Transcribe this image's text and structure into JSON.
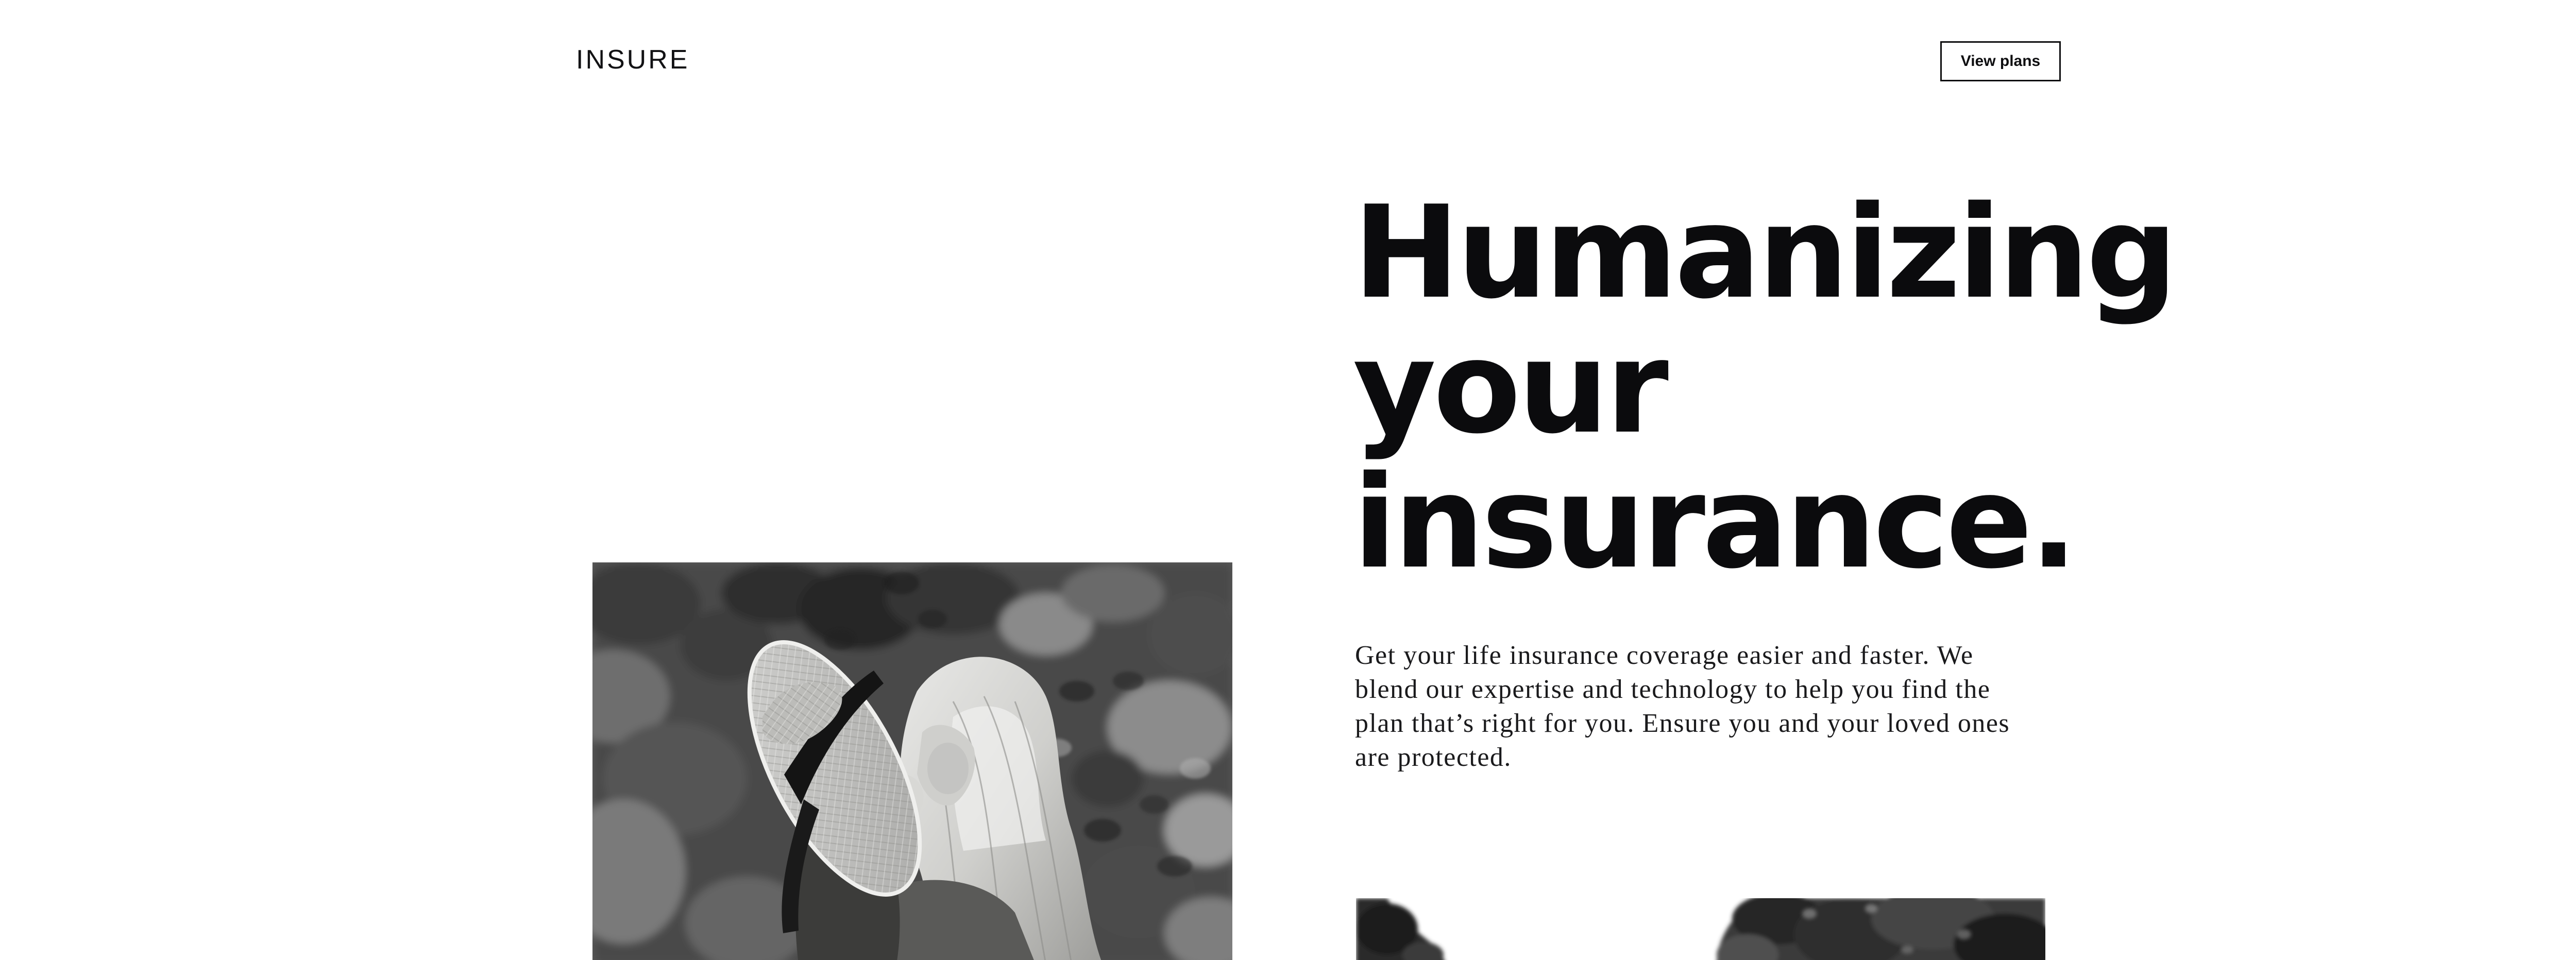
{
  "header": {
    "logo_text": "INSURE",
    "cta_label": "View plans"
  },
  "hero": {
    "title_lines": [
      "Humanizing",
      "your",
      "insurance."
    ],
    "description": "Get your life insurance coverage easier and faster. We blend our expertise and technology to help you find the plan that’s right for you. Ensure you and your loved ones are protected."
  },
  "images": {
    "main": "mother-and-daughter-photo",
    "secondary": "treetops-photo"
  },
  "colors": {
    "text": "#0b0b0d",
    "background": "#ffffff",
    "button_border": "#0e0e10"
  }
}
